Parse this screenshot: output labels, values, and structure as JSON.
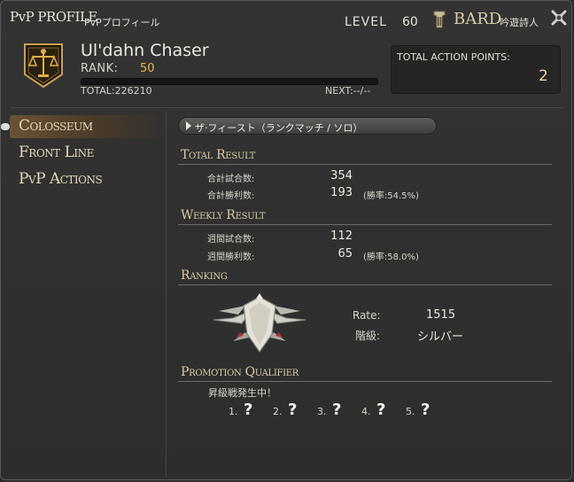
{
  "title": {
    "en": "PvP PROFILE",
    "jp": "PvPプロフィール"
  },
  "level": {
    "label": "LEVEL",
    "value": "60"
  },
  "job": {
    "name": "BARD",
    "jp": "吟遊詩人",
    "icon": "bard-job-icon"
  },
  "player": {
    "name": "Ul'dahn Chaser",
    "rank_label": "RANK:",
    "rank_value": "50",
    "total_exp": "TOTAL:226210",
    "next_exp": "NEXT:--/--",
    "emblem_icon": "grand-company-emblem-icon"
  },
  "action_points": {
    "label": "TOTAL ACTION POINTS:",
    "value": "2"
  },
  "sidebar": {
    "items": [
      {
        "label": "Colosseum",
        "active": true
      },
      {
        "label": "Front Line",
        "active": false
      },
      {
        "label": "PvP Actions",
        "active": false
      }
    ]
  },
  "mode_select": {
    "value": "ザ·フィースト（ランクマッチ / ソロ）"
  },
  "total_result": {
    "title": "Total Result",
    "matches_label": "合計試合数:",
    "matches_value": "354",
    "wins_label": "合計勝利数:",
    "wins_value": "193",
    "win_rate": "(勝率:54.5%)"
  },
  "weekly_result": {
    "title": "Weekly Result",
    "matches_label": "週間試合数:",
    "matches_value": "112",
    "wins_label": "週間勝利数:",
    "wins_value": "65",
    "win_rate": "(勝率:58.0%)"
  },
  "ranking": {
    "title": "Ranking",
    "rate_label": "Rate:",
    "rate_value": "1515",
    "tier_label": "階級:",
    "tier_value": "シルバー",
    "emblem_icon": "silver-tier-emblem-icon"
  },
  "promotion": {
    "title": "Promotion Qualifier",
    "status": "昇級戦発生中！",
    "slots": [
      {
        "num": "1.",
        "mark": "?"
      },
      {
        "num": "2.",
        "mark": "?"
      },
      {
        "num": "3.",
        "mark": "?"
      },
      {
        "num": "4.",
        "mark": "?"
      },
      {
        "num": "5.",
        "mark": "?"
      }
    ]
  },
  "colors": {
    "accent_gold": "#e9b44a",
    "header_text": "#d8cca6",
    "bg": "#2d2d2d"
  }
}
